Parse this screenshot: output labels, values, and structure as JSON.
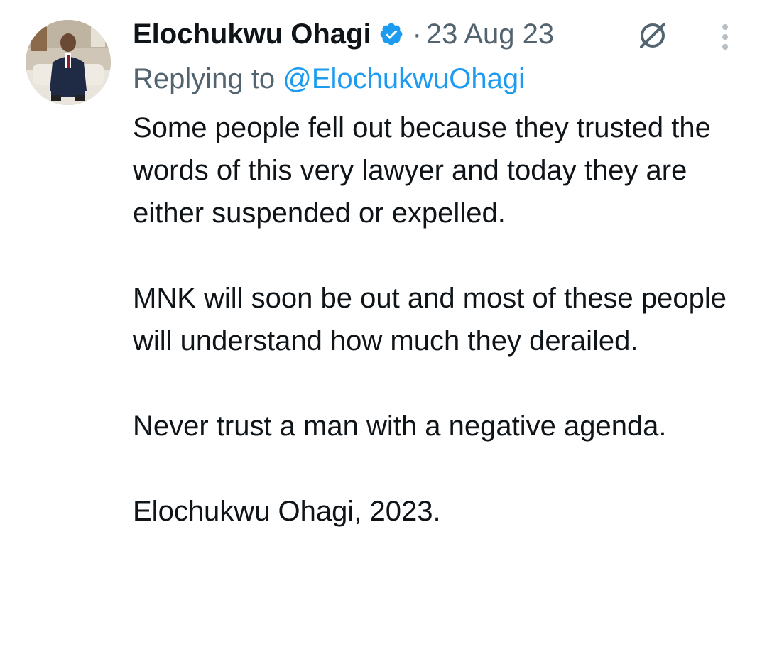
{
  "tweet": {
    "display_name": "Elochukwu Ohagi",
    "separator": "·",
    "date": "23 Aug 23",
    "replying_prefix": "Replying to ",
    "replying_handle": "@ElochukwuOhagi",
    "paragraphs": [
      "Some people fell out because they trusted the words of this very lawyer and today they are either suspended or expelled.",
      "MNK will soon be out and most of these people will understand how much they derailed.",
      "Never trust a man with a negative agenda.",
      "Elochukwu Ohagi, 2023."
    ]
  },
  "icons": {
    "verified": "verified-badge-icon",
    "grok": "grok-icon",
    "more": "more-vertical-icon"
  },
  "colors": {
    "text_primary": "#0f1419",
    "text_secondary": "#536471",
    "accent": "#1d9bf0"
  }
}
